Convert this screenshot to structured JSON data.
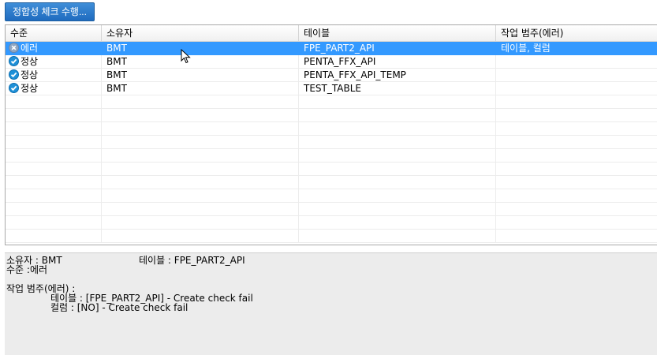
{
  "toolbar": {
    "run_check_label": "정합성 체크 수행..."
  },
  "grid": {
    "columns": [
      "수준",
      "소유자",
      "테이블",
      "작업 범주(에러)"
    ],
    "rows": [
      {
        "level": "에러",
        "status": "error",
        "owner": "BMT",
        "table": "FPE_PART2_API",
        "category": "테이블, 컬럼",
        "selected": true
      },
      {
        "level": "정상",
        "status": "ok",
        "owner": "BMT",
        "table": "PENTA_FFX_API",
        "category": "",
        "selected": false
      },
      {
        "level": "정상",
        "status": "ok",
        "owner": "BMT",
        "table": "PENTA_FFX_API_TEMP",
        "category": "",
        "selected": false
      },
      {
        "level": "정상",
        "status": "ok",
        "owner": "BMT",
        "table": "TEST_TABLE",
        "category": "",
        "selected": false
      }
    ]
  },
  "detail": {
    "owner_line": "소유자 : BMT",
    "table_line": "테이블 : FPE_PART2_API",
    "level_line": "수준 :에러",
    "category_header": "작업 범주(에러) :",
    "table_msg": "테이블 : [FPE_PART2_API] - Create check fail",
    "column_msg": "컬럼 : [NO] - Create check fail"
  },
  "colors": {
    "accent": "#3399ff",
    "button": "#2a7ccc",
    "ok_icon": "#1e90d8",
    "error_icon": "#8fa7c4",
    "detail_bg": "#ececec"
  },
  "icons": {
    "ok": "check-circle-icon",
    "error": "x-circle-icon"
  }
}
